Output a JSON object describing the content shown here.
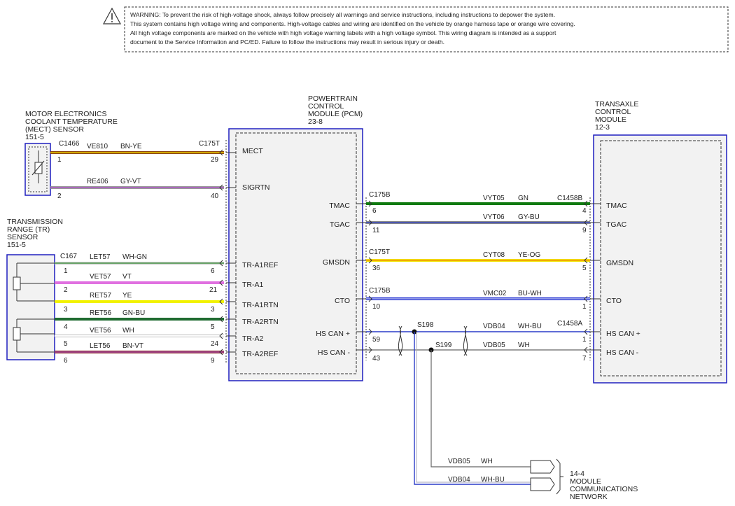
{
  "warning": {
    "lines": [
      "WARNING: To prevent the risk of high-voltage shock, always follow precisely all warnings and service instructions, including instructions to depower the system.",
      "This system contains high voltage wiring and components. High-voltage cables and wiring are identified on the vehicle by orange harness tape or orange wire covering.",
      "All high voltage components are marked on the vehicle with high voltage warning labels with a high voltage symbol. This wiring diagram is intended as a support",
      "document to the Service Information and PC/ED. Failure to follow the instructions may result in serious injury or death."
    ]
  },
  "mect": {
    "title": [
      "MOTOR ELECTRONICS",
      "COOLANT TEMPERATURE",
      "(MECT) SENSOR",
      "151-5"
    ],
    "connector": "C1466",
    "pin1": "1",
    "pin2": "2"
  },
  "tr": {
    "title": [
      "TRANSMISSION",
      "RANGE (TR)",
      "SENSOR",
      "151-5"
    ],
    "connector": "C167"
  },
  "pcm": {
    "title": [
      "POWERTRAIN",
      "CONTROL",
      "MODULE (PCM)",
      "23-8"
    ],
    "conn_left": "C175T",
    "left_pins": [
      "MECT",
      "SIGRTN",
      "TR-A1REF",
      "TR-A1",
      "TR-A1RTN",
      "TR-A2RTN",
      "TR-A2",
      "TR-A2REF"
    ],
    "right_pins": [
      "TMAC",
      "TGAC",
      "GMSDN",
      "CTO",
      "HS CAN +",
      "HS CAN -"
    ]
  },
  "tcm": {
    "title": [
      "TRANSAXLE",
      "CONTROL",
      "MODULE",
      "12-3"
    ],
    "pins": [
      "TMAC",
      "TGAC",
      "GMSDN",
      "CTO",
      "HS CAN +",
      "HS CAN -"
    ]
  },
  "left_wires": [
    {
      "circuit": "VE810",
      "color": "BN-YE",
      "pin_a": "1",
      "pin_b": "29"
    },
    {
      "circuit": "RE406",
      "color": "GY-VT",
      "pin_a": "2",
      "pin_b": "40"
    },
    {
      "circuit": "LET57",
      "color": "WH-GN",
      "pin_a": "1",
      "pin_b": "6"
    },
    {
      "circuit": "VET57",
      "color": "VT",
      "pin_a": "2",
      "pin_b": "21"
    },
    {
      "circuit": "RET57",
      "color": "YE",
      "pin_a": "3",
      "pin_b": "3"
    },
    {
      "circuit": "RET56",
      "color": "GN-BU",
      "pin_a": "4",
      "pin_b": "5"
    },
    {
      "circuit": "VET56",
      "color": "WH",
      "pin_a": "5",
      "pin_b": "24"
    },
    {
      "circuit": "LET56",
      "color": "BN-VT",
      "pin_a": "6",
      "pin_b": "9"
    }
  ],
  "right_wires": [
    {
      "conn_a": "C175B",
      "circuit": "VYT05",
      "color": "GN",
      "conn_b": "C1458B",
      "pin_a": "6",
      "pin_b": "4"
    },
    {
      "conn_a": "",
      "circuit": "VYT06",
      "color": "GY-BU",
      "conn_b": "",
      "pin_a": "11",
      "pin_b": "9"
    },
    {
      "conn_a": "C175T",
      "circuit": "CYT08",
      "color": "YE-OG",
      "conn_b": "",
      "pin_a": "36",
      "pin_b": "5"
    },
    {
      "conn_a": "C175B",
      "circuit": "VMC02",
      "color": "BU-WH",
      "conn_b": "",
      "pin_a": "10",
      "pin_b": "1"
    },
    {
      "conn_a": "",
      "circuit": "VDB04",
      "color": "WH-BU",
      "conn_b": "C1458A",
      "pin_a": "59",
      "pin_b": "1"
    },
    {
      "conn_a": "",
      "circuit": "VDB05",
      "color": "WH",
      "conn_b": "",
      "pin_a": "43",
      "pin_b": "7"
    }
  ],
  "splices": [
    "S198",
    "S199"
  ],
  "network": {
    "wires": [
      {
        "circuit": "VDB05",
        "color": "WH"
      },
      {
        "circuit": "VDB04",
        "color": "WH-BU"
      }
    ],
    "label": [
      "14-4",
      "MODULE",
      "COMMUNICATIONS",
      "NETWORK"
    ]
  }
}
